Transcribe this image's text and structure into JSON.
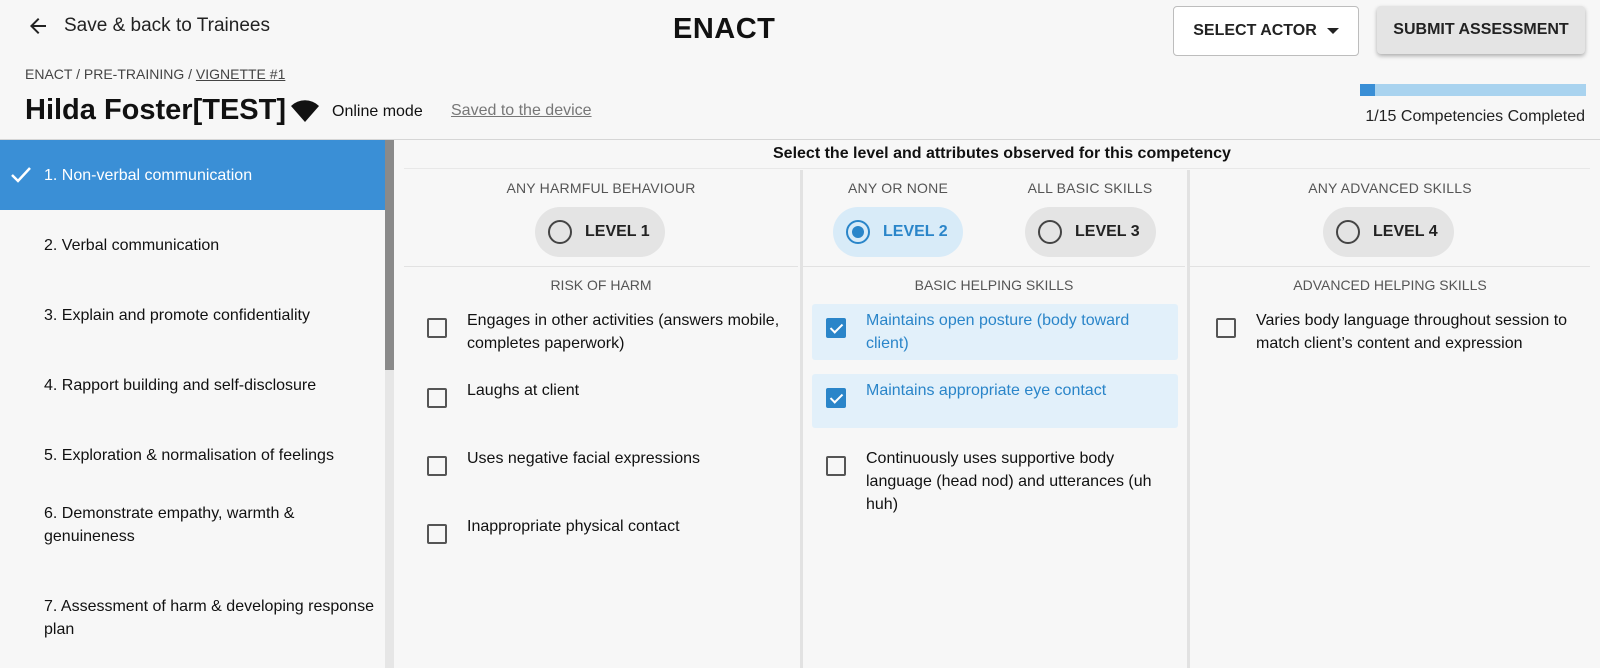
{
  "header": {
    "back_label": "Save & back to Trainees",
    "app_title": "ENACT",
    "select_actor_label": "SELECT ACTOR",
    "submit_label": "SUBMIT ASSESSMENT"
  },
  "breadcrumb": {
    "part1": "ENACT",
    "part2": "PRE-TRAINING",
    "current": "VIGNETTE #1",
    "separator": " / "
  },
  "trainee": {
    "name": "Hilda Foster[TEST]",
    "mode": "Online mode",
    "save_status": "Saved to the device"
  },
  "progress": {
    "completed": 1,
    "total": 15,
    "fraction": 0.0667,
    "label": "1/15 Competencies Completed"
  },
  "sidebar": {
    "items": [
      {
        "label": "1. Non-verbal communication",
        "active": true
      },
      {
        "label": "2. Verbal communication",
        "active": false
      },
      {
        "label": "3. Explain and promote confidentiality",
        "active": false
      },
      {
        "label": "4. Rapport building and self-disclosure",
        "active": false
      },
      {
        "label": "5. Exploration & normalisation of feelings",
        "active": false
      },
      {
        "label": "6. Demonstrate empathy, warmth & genuineness",
        "active": false
      },
      {
        "label": "7. Assessment of harm & developing response plan",
        "active": false
      }
    ]
  },
  "main": {
    "instruction": "Select the level and attributes observed for this competency",
    "levels": [
      {
        "category": "ANY HARMFUL BEHAVIOUR",
        "label": "LEVEL 1",
        "selected": false
      },
      {
        "category": "ANY OR NONE",
        "label": "LEVEL 2",
        "selected": true
      },
      {
        "category": "ALL BASIC SKILLS",
        "label": "LEVEL 3",
        "selected": false
      },
      {
        "category": "ANY ADVANCED SKILLS",
        "label": "LEVEL 4",
        "selected": false
      }
    ],
    "columns": [
      {
        "heading": "RISK OF HARM",
        "attributes": [
          {
            "text": "Engages in other activities (answers mobile, completes paperwork)",
            "checked": false
          },
          {
            "text": "Laughs at client",
            "checked": false
          },
          {
            "text": "Uses negative facial expressions",
            "checked": false
          },
          {
            "text": "Inappropriate physical contact",
            "checked": false
          }
        ]
      },
      {
        "heading": "BASIC HELPING SKILLS",
        "attributes": [
          {
            "text": "Maintains open posture (body toward client)",
            "checked": true
          },
          {
            "text": "Maintains appropriate eye contact",
            "checked": true
          },
          {
            "text": "Continuously uses supportive body language (head nod) and utterances (uh huh)",
            "checked": false
          }
        ]
      },
      {
        "heading": "ADVANCED HELPING SKILLS",
        "attributes": [
          {
            "text": "Varies body language throughout session to match client’s content and expression",
            "checked": false
          }
        ]
      }
    ]
  },
  "colors": {
    "accent": "#3a8fd6",
    "accent_text": "#2a85c9",
    "selected_bg": "#e2f0fa",
    "progress_track": "#a9d3ef"
  },
  "icons": {
    "back": "arrow-left-icon",
    "actor_dropdown": "caret-down-icon",
    "mode": "wifi-icon",
    "active_item": "checkmark-icon"
  }
}
